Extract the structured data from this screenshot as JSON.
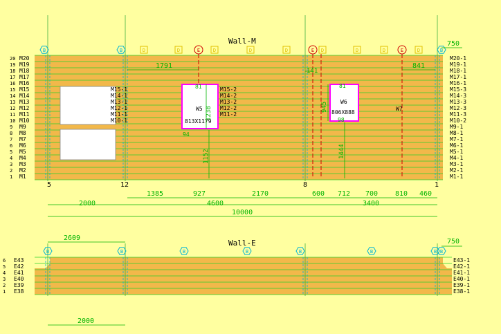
{
  "colors": {
    "background": "#ffffa0",
    "wall_fill": "#f2b84a",
    "course_line": "#2ad02a",
    "dimension": "#00b400",
    "grid_line": "#40b040",
    "marker_cyan": "#00b4d8",
    "marker_yellow": "#e0c000",
    "marker_red": "#d00000",
    "opening_edge": "#ff00ff",
    "text": "#000000"
  },
  "wall_m": {
    "title": "Wall-M",
    "overall_width_label": "750",
    "row_numbers": [
      "20",
      "19",
      "18",
      "17",
      "16",
      "15",
      "14",
      "13",
      "12",
      "11",
      "10",
      "9",
      "8",
      "7",
      "6",
      "5",
      "4",
      "3",
      "2",
      "1"
    ],
    "left_courses": [
      "M20",
      "M19",
      "M18",
      "M17",
      "M16",
      "M15",
      "M14",
      "M13",
      "M12",
      "M11",
      "M10",
      "M9",
      "M8",
      "M7",
      "M6",
      "M5",
      "M4",
      "M3",
      "M2",
      "M1"
    ],
    "right_courses": [
      "M20-1",
      "M19-1",
      "M18-1",
      "M17-1",
      "M16-1",
      "M15-3",
      "M14-3",
      "M13-3",
      "M12-3",
      "M11-3",
      "M10-2",
      "M9-1",
      "M8-1",
      "M7-1",
      "M6-1",
      "M5-1",
      "M4-1",
      "M3-1",
      "M2-1",
      "M1-1"
    ],
    "left_opening_tags": [
      "M15-1",
      "M14-1",
      "M13-1",
      "M12-1",
      "M11-1",
      "M10-1"
    ],
    "window_w5": {
      "name": "W5",
      "size": "813X1179",
      "height_dim": "1238",
      "sill_dim": "1152",
      "tags": [
        "M15-2",
        "M14-2",
        "M13-2",
        "M12-2",
        "M11-2"
      ],
      "side_dim": "94",
      "top_dim": "81"
    },
    "window_w6": {
      "name": "W6",
      "size": "806X888",
      "height_dim": "945",
      "sill_dim": "1444",
      "top_dim": "81",
      "side_dim": "98"
    },
    "window_w7": {
      "name": "W7"
    },
    "dim_1791": "1791",
    "dim_841": "841",
    "dim_141": "141",
    "axis_labels": [
      "5",
      "12",
      "8",
      "1"
    ],
    "segment_dims": [
      "1385",
      "927",
      "2170",
      "600",
      "712",
      "700",
      "810",
      "460"
    ],
    "span_dims": [
      "2000",
      "4600",
      "3400"
    ],
    "total_dim": "10000",
    "marker_letters": {
      "b": "B",
      "d": "D",
      "e": "E"
    }
  },
  "wall_e": {
    "title": "Wall-E",
    "overall_width_label": "750",
    "top_dim": "2609",
    "bottom_dim": "2000",
    "row_numbers": [
      "6",
      "5",
      "4",
      "3",
      "2",
      "1"
    ],
    "left_courses": [
      "E43",
      "E42",
      "E41",
      "E40",
      "E39",
      "E38"
    ],
    "right_courses": [
      "E43-1",
      "E42-1",
      "E41-1",
      "E40-1",
      "E39-1",
      "E38-1"
    ]
  }
}
